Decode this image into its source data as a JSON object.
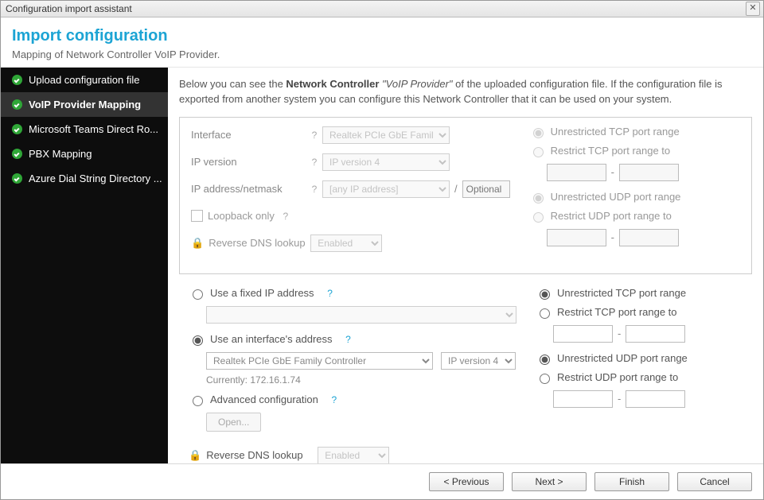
{
  "window": {
    "title": "Configuration import assistant"
  },
  "header": {
    "title": "Import configuration",
    "subtitle": "Mapping of Network Controller VoIP Provider."
  },
  "sidebar": {
    "items": [
      {
        "label": "Upload configuration file"
      },
      {
        "label": "VoIP Provider Mapping",
        "active": true
      },
      {
        "label": "Microsoft Teams Direct Ro..."
      },
      {
        "label": "PBX Mapping"
      },
      {
        "label": "Azure Dial String Directory ..."
      }
    ]
  },
  "intro": {
    "pre": "Below you can see the ",
    "bold": "Network Controller",
    "italic": " \"VoIP Provider\" ",
    "post": "of the uploaded configuration file. If the configuration file is exported from another system you can configure this Network Controller that it can be used on your system."
  },
  "panel": {
    "interface_label": "Interface",
    "interface_value": "Realtek PCIe GbE Family Contr",
    "ipver_label": "IP version",
    "ipver_value": "IP version 4",
    "ipaddr_label": "IP address/netmask",
    "ipaddr_value": "[any IP address]",
    "netmask_placeholder": "Optional",
    "loopback_label": "Loopback only",
    "revdns_label": "Reverse DNS lookup",
    "revdns_value": "Enabled",
    "tcp_unrestricted": "Unrestricted TCP port range",
    "tcp_restrict": "Restrict TCP port range to",
    "udp_unrestricted": "Unrestricted UDP port range",
    "udp_restrict": "Restrict UDP port range to"
  },
  "section": {
    "fixed_ip": "Use a fixed IP address",
    "iface_addr": "Use an interface's address",
    "iface_value": "Realtek PCIe GbE Family Controller",
    "ipver_value": "IP version 4",
    "current": "Currently: 172.16.1.74",
    "advanced": "Advanced configuration",
    "open": "Open...",
    "revdns_label": "Reverse DNS lookup",
    "revdns_value": "Enabled",
    "tcp_unrestricted": "Unrestricted TCP port range",
    "tcp_restrict": "Restrict TCP port range to",
    "udp_unrestricted": "Unrestricted UDP port range",
    "udp_restrict": "Restrict UDP port range to"
  },
  "footer": {
    "prev": "< Previous",
    "next": "Next >",
    "finish": "Finish",
    "cancel": "Cancel"
  }
}
